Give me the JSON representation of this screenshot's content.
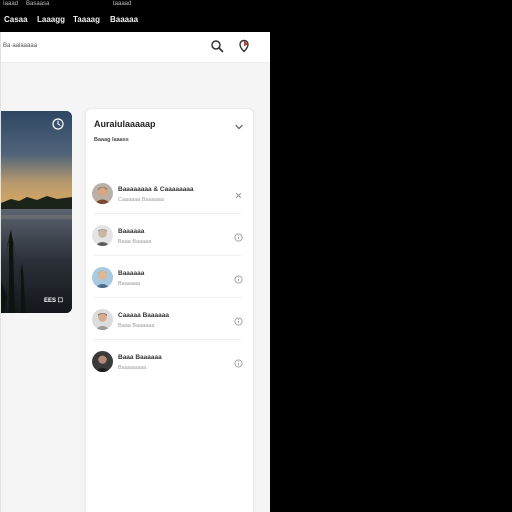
{
  "topbar": {
    "tiny_labels": [
      "Iaaad",
      "Basaasa",
      "taaaad"
    ],
    "menu": [
      "Casaa",
      "Laaagg",
      "Taaaag",
      "Baaaaa"
    ]
  },
  "header": {
    "breadcrumb": "Ba·aalaaaaa",
    "icons": [
      "search-icon",
      "location-pin-icon"
    ]
  },
  "photo": {
    "caption": "EES ☐",
    "icon": "clock-icon"
  },
  "list": {
    "title": "Auraiulaaaaap",
    "subtitle": "Baaag Iaaass",
    "items": [
      {
        "name": "Baaaaaaaa & Caaaaaaaa",
        "sub": "Caaaaaa Baaaaaa",
        "action": "close-icon"
      },
      {
        "name": "Baaaaaa",
        "sub": "Baaa Baaaaa",
        "action": "info-icon"
      },
      {
        "name": "Baaaaaa",
        "sub": "Baaaaaa",
        "action": "info-icon"
      },
      {
        "name": "Caaaaa Baaaaaa",
        "sub": "Baaa Baaaaaa",
        "action": "info-icon"
      },
      {
        "name": "Baaa Baaaaaa",
        "sub": "Baaaaaaaa",
        "action": "info-icon"
      }
    ]
  },
  "colors": {
    "page_background": "#000000",
    "panel_background": "#f5f5f6",
    "card_background": "#ffffff"
  }
}
